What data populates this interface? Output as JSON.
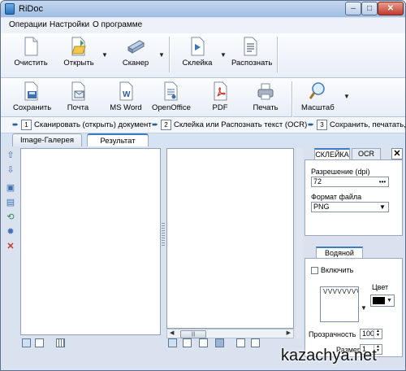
{
  "window": {
    "title": "RiDoc",
    "min": "–",
    "max": "□",
    "close": "✕"
  },
  "menu": [
    "Операции",
    "Настройки",
    "О программе"
  ],
  "toolbar1": {
    "clear": "Очистить",
    "open": "Открыть",
    "scanner": "Сканер",
    "glue": "Склейка",
    "recognize": "Распознать"
  },
  "toolbar2": {
    "save": "Сохранить",
    "mail": "Почта",
    "msword": "MS Word",
    "openoffice": "OpenOffice",
    "pdf": "PDF",
    "print": "Печать",
    "zoom": "Масштаб"
  },
  "steps": [
    {
      "num": "1",
      "text": "Сканировать (открыть) документ"
    },
    {
      "num": "2",
      "text": "Склейка или Распознать текст (OCR)"
    },
    {
      "num": "3",
      "text": "Сохранить, печатать,"
    }
  ],
  "tabs": {
    "gallery": "Image-Галерея",
    "result": "Результат"
  },
  "right_panel": {
    "tab_glue": "СКЛЕЙКА",
    "tab_ocr": "OCR",
    "close": "✕",
    "resolution_label": "Разрешение (dpi)",
    "resolution_value": "72",
    "resolution_btn": "•••",
    "format_label": "Формат файла",
    "format_value": "PNG",
    "watermark_tab": "Водяной знак",
    "enable_label": "Включить",
    "color_label": "Цвет",
    "opacity_label": "Прозрачность",
    "opacity_value": "100",
    "size_label": "Размер",
    "size_value": "1",
    "pattern": "VVVVVVVVVVVVVVVVVVVVVVVVVVVVVVVVVVVVVVVVVV"
  },
  "watermark_text": "kazachya.net"
}
